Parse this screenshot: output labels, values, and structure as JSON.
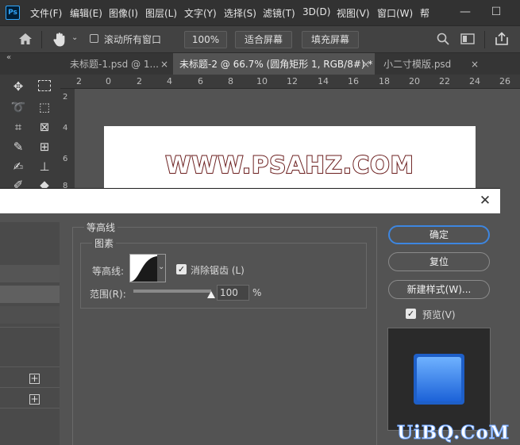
{
  "app": {
    "logo": "Ps",
    "menu": [
      "文件(F)",
      "编辑(E)",
      "图像(I)",
      "图层(L)",
      "文字(Y)",
      "选择(S)",
      "滤镜(T)",
      "3D(D)",
      "视图(V)",
      "窗口(W)",
      "帮"
    ],
    "window_controls": {
      "minimize": "—",
      "maximize": "☐"
    }
  },
  "options": {
    "scroll_all_label": "滚动所有窗口",
    "zoom_value": "100%",
    "fit_screen_label": "适合屏幕",
    "fill_screen_label": "填充屏幕"
  },
  "tabs": [
    {
      "label": "未标题-1.psd @ 1...",
      "close": "×"
    },
    {
      "label": "未标题-2 @ 66.7% (圆角矩形 1, RGB/8#) *",
      "close": "×"
    },
    {
      "label": "小二寸模版.psd",
      "close": "×"
    }
  ],
  "ruler": {
    "h_ticks": [
      "2",
      "0",
      "2",
      "4",
      "6",
      "8",
      "10",
      "12",
      "14",
      "16",
      "18",
      "20",
      "22",
      "24",
      "26"
    ],
    "v_ticks": [
      "2",
      "4",
      "6",
      "8"
    ]
  },
  "canvas": {
    "watermark": "WWW.PSAHZ.COM"
  },
  "dialog": {
    "close": "✕",
    "contour_group_title": "等高线",
    "elements_group_title": "图素",
    "contour_label": "等高线:",
    "antialias_label": "消除锯齿 (L)",
    "range_label": "范围(R):",
    "range_value": "100",
    "range_unit": "%",
    "range_fraction": 1.0,
    "ok_label": "确定",
    "reset_label": "复位",
    "new_style_label": "新建样式(W)...",
    "preview_label": "预览(V)",
    "plus": "+"
  },
  "footer_watermark": "UiBQ.CoM",
  "colors": {
    "accent": "#3d86e0",
    "preview_blue": "#3b8cf0",
    "text_stroke": "#6b1e1e"
  }
}
